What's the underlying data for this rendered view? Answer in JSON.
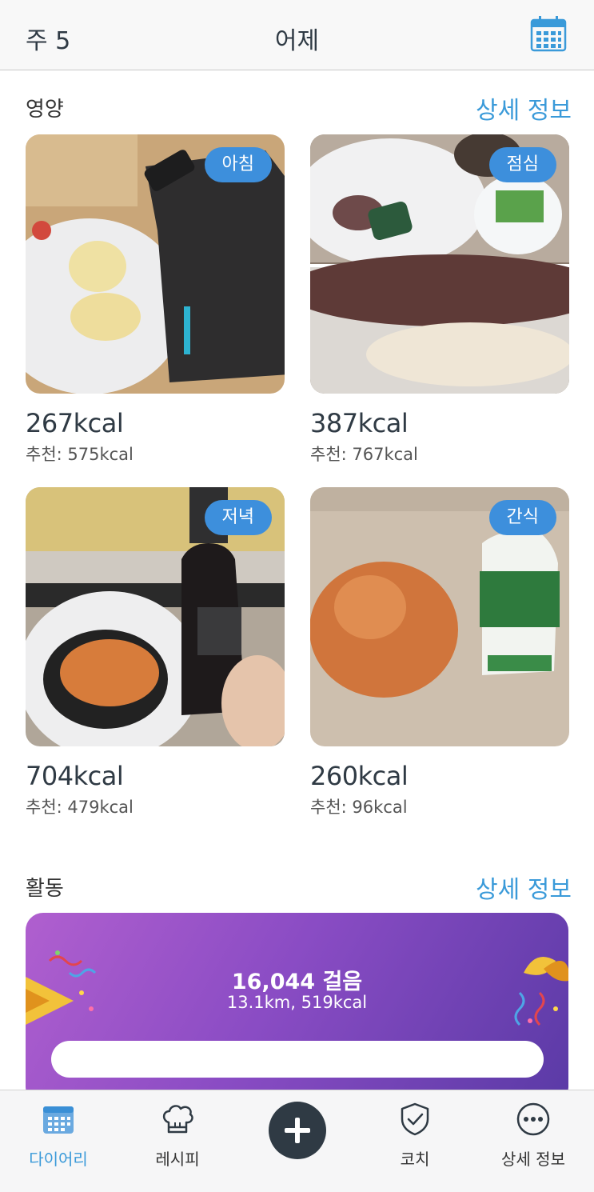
{
  "header": {
    "week": "주 5",
    "title": "어제",
    "calendar_icon": "calendar-icon"
  },
  "nutrition": {
    "title": "영양",
    "details_link": "상세 정보",
    "meals": [
      {
        "badge": "아침",
        "kcal": "267kcal",
        "recommended": "추천: 575kcal"
      },
      {
        "badge": "점심",
        "kcal": "387kcal",
        "recommended": "추천: 767kcal"
      },
      {
        "badge": "저녁",
        "kcal": "704kcal",
        "recommended": "추천: 479kcal"
      },
      {
        "badge": "간식",
        "kcal": "260kcal",
        "recommended": "추천: 96kcal"
      }
    ]
  },
  "activity": {
    "title": "활동",
    "details_link": "상세 정보",
    "steps": "16,044 걸음",
    "summary": "13.1km, 519kcal"
  },
  "tabbar": {
    "items": [
      {
        "label": "다이어리",
        "icon": "calendar-icon",
        "active": true
      },
      {
        "label": "레시피",
        "icon": "chef-hat-icon",
        "active": false
      },
      {
        "label": "",
        "icon": "plus-icon",
        "active": false
      },
      {
        "label": "코치",
        "icon": "shield-check-icon",
        "active": false
      },
      {
        "label": "상세 정보",
        "icon": "more-icon",
        "active": false
      }
    ]
  },
  "colors": {
    "accent": "#3a9ad9",
    "badge": "#3d8fdc",
    "activity_gradient_start": "#b05fcf",
    "activity_gradient_end": "#5a3aa6",
    "dark": "#2f3a44"
  }
}
